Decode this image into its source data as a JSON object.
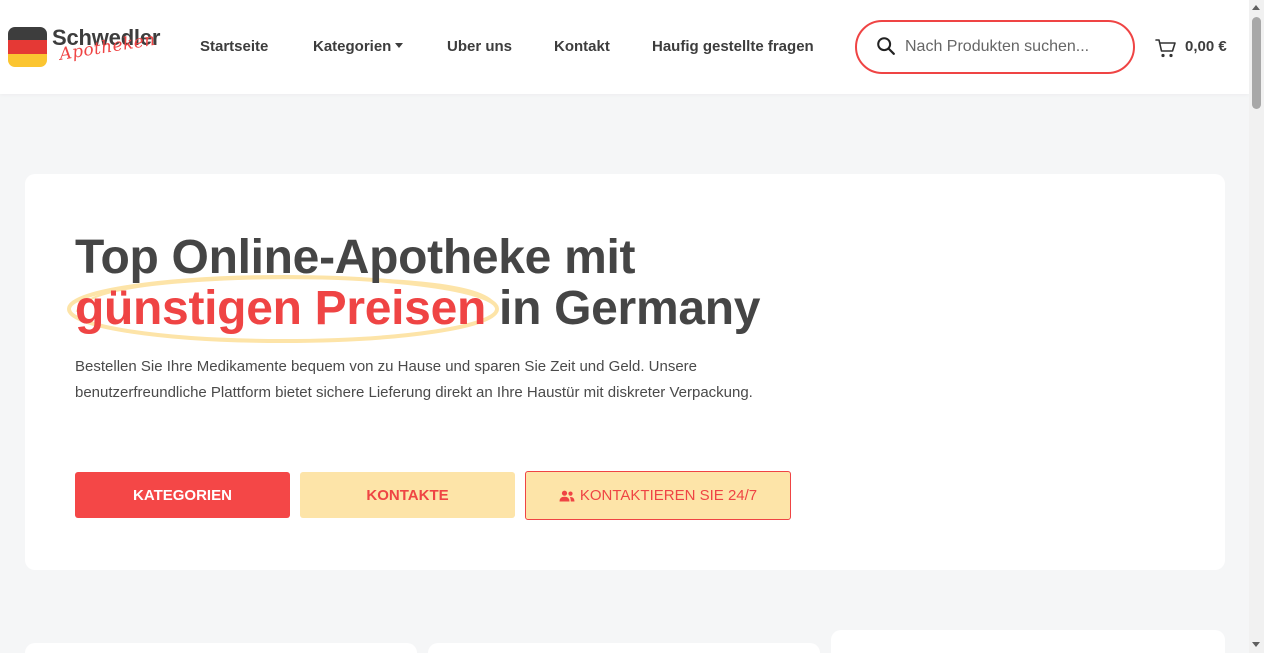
{
  "brand": {
    "name": "Schwedler",
    "tagline": "Apotheken",
    "flag_colors": [
      "#3d3d3d",
      "#e53935",
      "#fbc531"
    ]
  },
  "nav": {
    "items": [
      {
        "label": "Startseite"
      },
      {
        "label": "Kategorien",
        "has_dropdown": true
      },
      {
        "label": "Uber uns"
      },
      {
        "label": "Kontakt"
      },
      {
        "label": "Haufig gestellte fragen"
      }
    ]
  },
  "search": {
    "placeholder": "Nach Produkten suchen...",
    "value": ""
  },
  "cart": {
    "amount": "0,00 €"
  },
  "hero": {
    "title_line1": "Top Online-Apotheke mit",
    "title_highlight": "günstigen Preisen",
    "title_rest": " in Germany",
    "description": "Bestellen Sie Ihre Medikamente bequem von zu Hause und sparen Sie Zeit und Geld. Unsere benutzerfreundliche Plattform bietet sichere Lieferung direkt an Ihre Haustür mit diskreter Verpackung.",
    "buttons": {
      "primary": "KATEGORIEN",
      "secondary": "KONTAKTE",
      "contact": "KONTAKTIEREN SIE 24/7"
    }
  },
  "colors": {
    "accent": "#ef4444",
    "highlight_yellow": "#fde4a8",
    "text_dark": "#454545"
  }
}
